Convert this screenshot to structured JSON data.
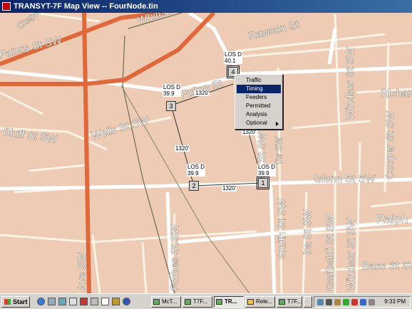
{
  "window": {
    "title": "TRANSYT-7F Map View -- FourNode.tin"
  },
  "streets": [
    "Paters St SW",
    "Whitehall",
    "Rawson St",
    "Fulton St",
    "Windsor St SW",
    "Richardson",
    "Wells St SW",
    "Bluff St SW",
    "Cooper St SW",
    "Glenn St SW",
    "Ralph",
    "Smith St SW",
    "Ira St SW",
    "Garibaldi St SW",
    "Windsor St SW",
    "Bass St SW",
    "Forbes St SW",
    "Ave SW",
    "Ter SW",
    "St SW",
    "Chapel"
  ],
  "nodes": [
    {
      "id": "1",
      "los": "LOS D",
      "delay": "39.9"
    },
    {
      "id": "2",
      "los": "LOS D",
      "delay": "39.9"
    },
    {
      "id": "3",
      "los": "LOS D",
      "delay": "39.9"
    },
    {
      "id": "4",
      "los": "LOS D",
      "delay": "40.1"
    }
  ],
  "links": {
    "a": "1320'",
    "b": "1320'",
    "c": "1320'",
    "d": "1320'"
  },
  "context_menu": {
    "items": [
      {
        "label": "Traffic"
      },
      {
        "label": "Timing"
      },
      {
        "label": "Feeders"
      },
      {
        "label": "Permitted"
      },
      {
        "label": "Analysis"
      },
      {
        "label": "Optional"
      }
    ]
  },
  "taskbar": {
    "start_label": "Start",
    "tasks": [
      "McT...",
      "T7F...",
      "TR...",
      "Rele...",
      "T7F...",
      "",
      ""
    ],
    "clock": "9:33 PM"
  },
  "colors": {
    "map_bg": "#eecbb4",
    "arterial": "#e0683a",
    "selected_menu": "#0a246a"
  }
}
